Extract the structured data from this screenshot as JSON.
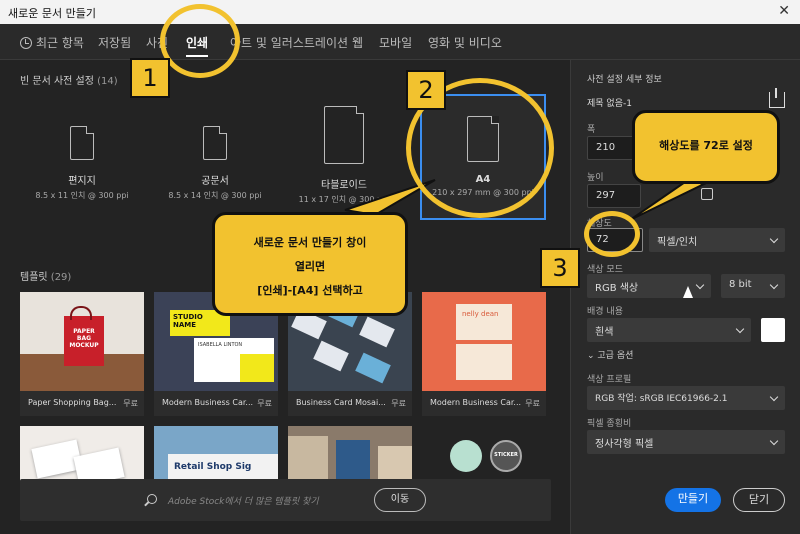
{
  "window": {
    "title": "새로운 문서 만들기",
    "close": "✕"
  },
  "tabs": [
    {
      "label": "최근 항목"
    },
    {
      "label": "저장됨"
    },
    {
      "label": "사진"
    },
    {
      "label": "인쇄"
    },
    {
      "label": "아트 및 일러스트레이션"
    },
    {
      "label": "웹"
    },
    {
      "label": "모바일"
    },
    {
      "label": "영화 및 비디오"
    }
  ],
  "presets_section": {
    "title": "빈 문서 사전 설정",
    "count": "(14)"
  },
  "presets": [
    {
      "name": "편지지",
      "dim": "8.5 x 11 인치 @ 300 ppi"
    },
    {
      "name": "공문서",
      "dim": "8.5 x 14 인치 @ 300 ppi"
    },
    {
      "name": "타블로이드",
      "dim": "11 x 17 인치 @ 300 ppi"
    },
    {
      "name": "A4",
      "dim": "210 x 297 mm @ 300 ppi"
    }
  ],
  "templates_section": {
    "title": "템플릿",
    "count": "(29)"
  },
  "templates": [
    {
      "name": "Paper Shopping Bag...",
      "price": "무료",
      "art": "PAPER BAG MOCKUP"
    },
    {
      "name": "Modern Business Car...",
      "price": "무료",
      "art": "STUDIO NAME",
      "art2": "ISABELLA LINTON"
    },
    {
      "name": "Business Card Mosai...",
      "price": "무료"
    },
    {
      "name": "Modern Business Car...",
      "price": "무료",
      "art": "nelly dean"
    }
  ],
  "templates_row2": [
    {
      "art": ""
    },
    {
      "art": "Retail Shop Sig"
    },
    {
      "art": ""
    },
    {
      "art": "STICKER"
    }
  ],
  "search": {
    "placeholder": "Adobe Stock에서 더 많은 템플릿 찾기",
    "go": "이동"
  },
  "details": {
    "title": "사전 설정 세부 정보",
    "doc_name": "제목 없음-1",
    "width_label": "폭",
    "width": "210",
    "height_label": "높이",
    "height": "297",
    "resolution_label": "해상도",
    "resolution": "72",
    "resolution_unit": "픽셀/인치",
    "color_mode_label": "색상 모드",
    "color_mode": "RGB 색상",
    "bit_depth": "8 bit",
    "background_label": "배경 내용",
    "background": "흰색",
    "advanced": "고급 옵션",
    "profile_label": "색상 프로필",
    "profile": "RGB 작업: sRGB IEC61966-2.1",
    "pixel_ratio_label": "픽셀 종횡비",
    "pixel_ratio": "정사각형 픽셀"
  },
  "buttons": {
    "create": "만들기",
    "close": "닫기"
  },
  "annotations": {
    "n1": "1",
    "n2": "2",
    "n3": "3",
    "callout_main_l1": "새로운 문서 만들기 창이",
    "callout_main_l2": "열리면",
    "callout_main_l3": "[인쇄]-[A4] 선택하고",
    "callout_res": "해상도를 72로 설정"
  },
  "colors": {
    "accent": "#3b8ef0",
    "highlight": "#f2c22f"
  }
}
